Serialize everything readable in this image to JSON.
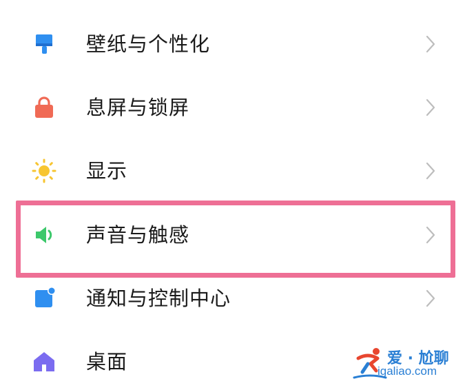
{
  "settings": {
    "items": [
      {
        "label": "壁纸与个性化",
        "icon": "paintbrush-icon",
        "icon_color": "#2f8ff0"
      },
      {
        "label": "息屏与锁屏",
        "icon": "lock-icon",
        "icon_color": "#f06a55"
      },
      {
        "label": "显示",
        "icon": "sun-icon",
        "icon_color": "#f7c531"
      },
      {
        "label": "声音与触感",
        "icon": "speaker-icon",
        "icon_color": "#3cc86b"
      },
      {
        "label": "通知与控制中心",
        "icon": "notification-icon",
        "icon_color": "#2f8ff0"
      },
      {
        "label": "桌面",
        "icon": "home-icon",
        "icon_color": "#7b6cf0"
      }
    ],
    "highlighted_index": 3,
    "highlight_color": "#ee6f95"
  },
  "watermark": {
    "top_text": "爱 · 尬聊",
    "bottom_text": "igaliao.com",
    "color": "#2a7fd4"
  }
}
